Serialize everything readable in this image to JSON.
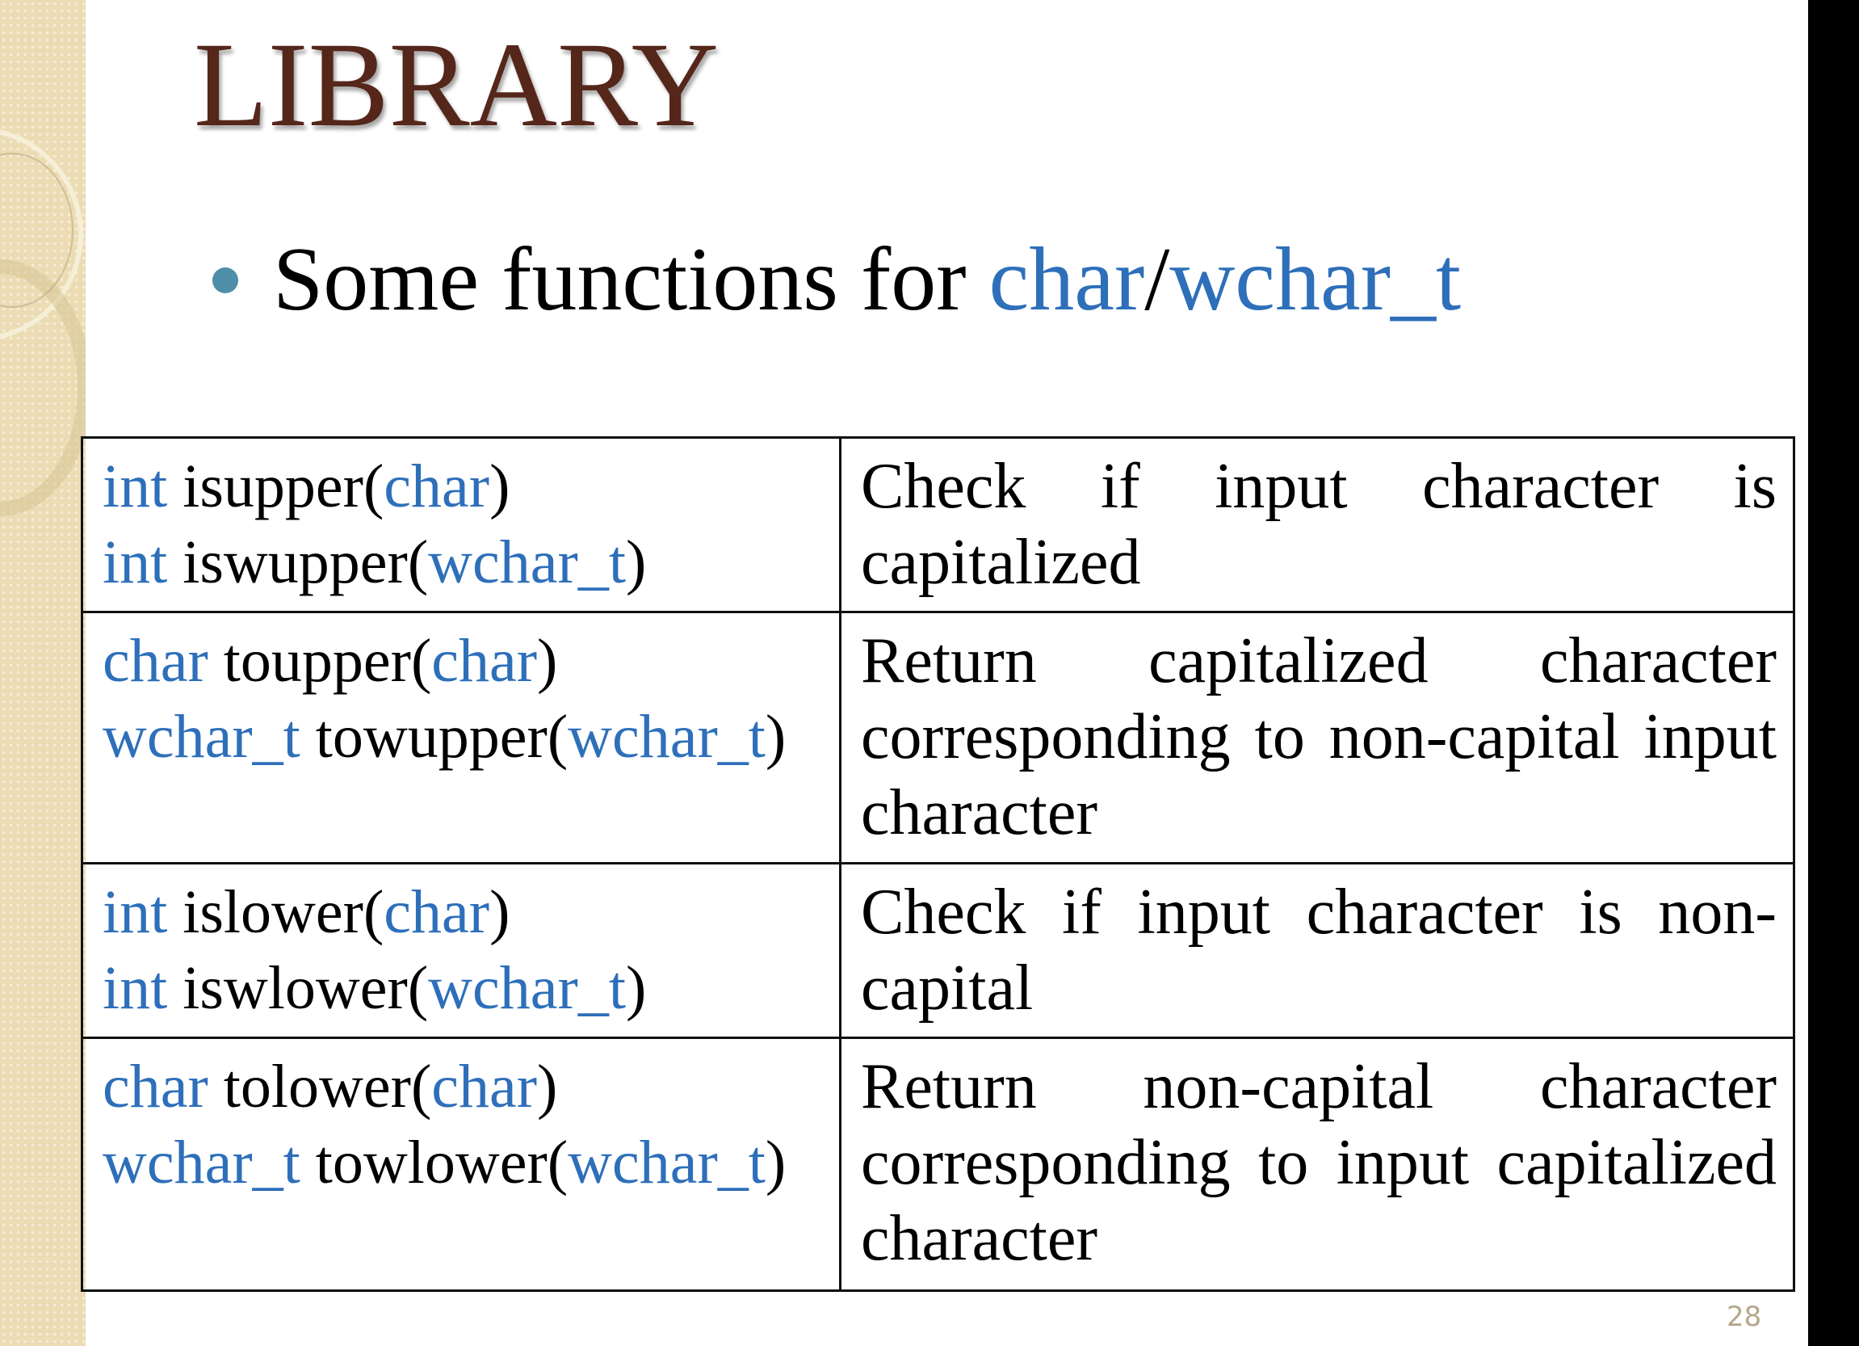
{
  "slide": {
    "title": "LIBRARY",
    "bullet": {
      "prefix": "Some functions for ",
      "highlight1": "char",
      "sep": "/",
      "highlight2": "wchar_t"
    },
    "page_number": "28",
    "colors": {
      "title": "#55261a",
      "keyword": "#2e6fba",
      "bullet": "#4f8fa8"
    }
  },
  "table": {
    "rows": [
      {
        "sigs": [
          [
            {
              "t": "int",
              "k": true
            },
            {
              "t": " isupper(",
              "k": false
            },
            {
              "t": "char",
              "k": true
            },
            {
              "t": ")",
              "k": false
            }
          ],
          [
            {
              "t": "int",
              "k": true
            },
            {
              "t": " iswupper(",
              "k": false
            },
            {
              "t": "wchar_t",
              "k": true
            },
            {
              "t": ")",
              "k": false
            }
          ]
        ],
        "desc": "Check if input character is capitalized"
      },
      {
        "sigs": [
          [
            {
              "t": "char",
              "k": true
            },
            {
              "t": " toupper(",
              "k": false
            },
            {
              "t": "char",
              "k": true
            },
            {
              "t": ")",
              "k": false
            }
          ],
          [
            {
              "t": "wchar_t",
              "k": true
            },
            {
              "t": " towupper(",
              "k": false
            },
            {
              "t": "wchar_t",
              "k": true
            },
            {
              "t": ")",
              "k": false
            }
          ]
        ],
        "desc": "Return capitalized character corresponding to non-capital input character"
      },
      {
        "sigs": [
          [
            {
              "t": "int",
              "k": true
            },
            {
              "t": " islower(",
              "k": false
            },
            {
              "t": "char",
              "k": true
            },
            {
              "t": ")",
              "k": false
            }
          ],
          [
            {
              "t": "int",
              "k": true
            },
            {
              "t": " iswlower(",
              "k": false
            },
            {
              "t": "wchar_t",
              "k": true
            },
            {
              "t": ")",
              "k": false
            }
          ]
        ],
        "desc": "Check if input character is non-capital"
      },
      {
        "sigs": [
          [
            {
              "t": "char",
              "k": true
            },
            {
              "t": " tolower(",
              "k": false
            },
            {
              "t": "char",
              "k": true
            },
            {
              "t": ")",
              "k": false
            }
          ],
          [
            {
              "t": "wchar_t",
              "k": true
            },
            {
              "t": " towlower(",
              "k": false
            },
            {
              "t": "wchar_t",
              "k": true
            },
            {
              "t": ")",
              "k": false
            }
          ]
        ],
        "desc": "Return non-capital character corresponding to input capitalized character"
      }
    ]
  }
}
